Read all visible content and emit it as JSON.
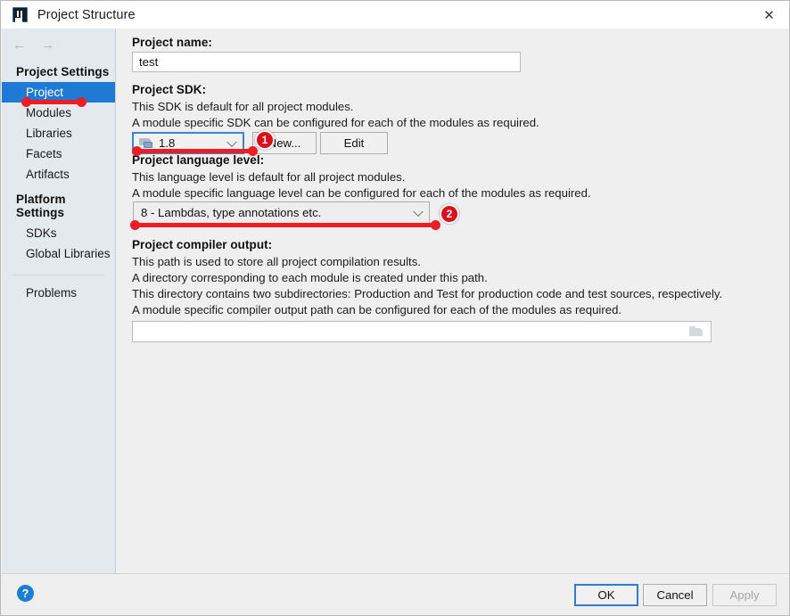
{
  "window": {
    "title": "Project Structure",
    "app_icon": "intellij-icon",
    "close_icon": "✕",
    "back_icon": "←",
    "forward_icon": "→"
  },
  "sidebar": {
    "groups": [
      {
        "label": "Project Settings",
        "items": [
          {
            "label": "Project",
            "selected": true
          },
          {
            "label": "Modules",
            "selected": false
          },
          {
            "label": "Libraries",
            "selected": false
          },
          {
            "label": "Facets",
            "selected": false
          },
          {
            "label": "Artifacts",
            "selected": false
          }
        ]
      },
      {
        "label": "Platform Settings",
        "items": [
          {
            "label": "SDKs",
            "selected": false
          },
          {
            "label": "Global Libraries",
            "selected": false
          }
        ]
      }
    ],
    "problems": "Problems"
  },
  "main": {
    "project_name": {
      "label": "Project name:",
      "value": "test",
      "placeholder": ""
    },
    "project_sdk": {
      "label": "Project SDK:",
      "desc_line1": "This SDK is default for all project modules.",
      "desc_line2": "A module specific SDK can be configured for each of the modules as required.",
      "selected": "1.8",
      "icon": "sdk-icon",
      "new_button": "New...",
      "edit_button": "Edit"
    },
    "language_level": {
      "label": "Project language level:",
      "desc_line1": "This language level is default for all project modules.",
      "desc_line2": "A module specific language level can be configured for each of the modules as required.",
      "selected": "8 - Lambdas, type annotations etc."
    },
    "compiler_output": {
      "label": "Project compiler output:",
      "desc_line1": "This path is used to store all project compilation results.",
      "desc_line2": "A directory corresponding to each module is created under this path.",
      "desc_line3": "This directory contains two subdirectories: Production and Test for production code and test sources, respectively.",
      "desc_line4": "A module specific compiler output path can be configured for each of the modules as required.",
      "value": "",
      "browse_icon": "folder-icon"
    }
  },
  "footer": {
    "help_icon": "?",
    "ok": "OK",
    "cancel": "Cancel",
    "apply": "Apply"
  },
  "annotations": {
    "badge_1": "1",
    "badge_2": "2",
    "color": "#ee1d24"
  }
}
